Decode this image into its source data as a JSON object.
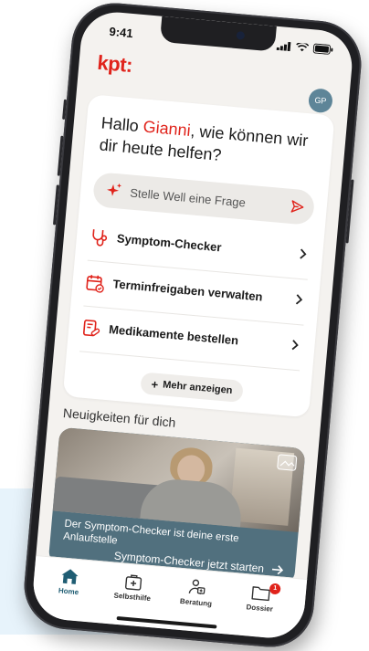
{
  "status": {
    "time": "9:41"
  },
  "brand": {
    "logo_text": "kpt:",
    "accent_color": "#e0231b",
    "primary_color": "#1f5d73"
  },
  "user": {
    "initials": "GP"
  },
  "greeting": {
    "prefix": "Hallo ",
    "name": "Gianni",
    "suffix": ", wie können wir dir heute helfen?"
  },
  "ask": {
    "placeholder": "Stelle Well eine Frage",
    "icon": "sparkle-icon",
    "send_icon": "send-icon"
  },
  "menu": [
    {
      "label": "Symptom-Checker",
      "icon": "stethoscope-icon"
    },
    {
      "label": "Terminfreigaben verwalten",
      "icon": "calendar-check-icon"
    },
    {
      "label": "Medikamente bestellen",
      "icon": "prescription-icon"
    }
  ],
  "more_button": {
    "label": "Mehr anzeigen"
  },
  "news": {
    "title": "Neuigkeiten für dich",
    "card_text": "Der Symptom-Checker ist deine erste Anlaufstelle",
    "cta": "Symptom-Checker jetzt starten"
  },
  "tabs": [
    {
      "label": "Home",
      "icon": "home-icon",
      "active": true
    },
    {
      "label": "Selbsthilfe",
      "icon": "first-aid-kit-icon",
      "active": false
    },
    {
      "label": "Beratung",
      "icon": "consultation-icon",
      "active": false
    },
    {
      "label": "Dossier",
      "icon": "folder-icon",
      "active": false,
      "badge": "1"
    }
  ]
}
